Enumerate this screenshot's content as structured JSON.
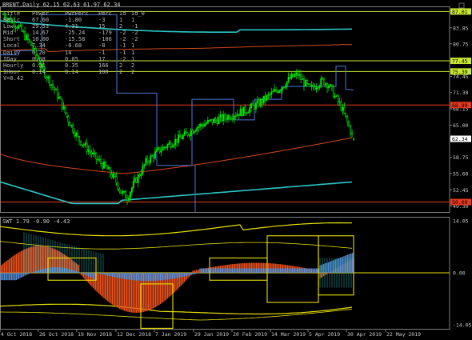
{
  "window": {
    "symbol_title": "BRENT,Daily  62.15 62.63 61.97 62.34",
    "oscillator_title": "SWT 1.79 -0.90 -4.43"
  },
  "info_table": {
    "headers": [
      "Title",
      "Power",
      "PwrPerc",
      "Perc",
      "Id",
      "Id_0"
    ],
    "rows": [
      [
        "Basic",
        "67.60",
        "-1.80",
        "-3",
        "1",
        "1"
      ],
      [
        "Low",
        "29.53",
        "4.31",
        "15",
        "2",
        "-1"
      ],
      [
        "Mid",
        "14.67",
        "-25.24",
        "-179",
        "-2",
        "-2"
      ],
      [
        "Short",
        "10.00",
        "-15.58",
        "-106",
        "-2",
        "-2"
      ],
      [
        "Local",
        "7.34",
        "-0.68",
        "-8",
        "-1",
        "1"
      ],
      [
        "Daily",
        "0.20",
        "14",
        "-1",
        "-1",
        "1"
      ],
      [
        "IDay",
        "0.08",
        "0.05",
        "17",
        "-2",
        "1"
      ],
      [
        "Hourly",
        "0.21",
        "0.35",
        "166",
        "2",
        "2"
      ],
      [
        "IHour",
        "0.14",
        "0.14",
        "100",
        "2",
        "2"
      ]
    ],
    "vol_label": "V=0.42"
  },
  "price_axis": {
    "ticks": [
      "83.85",
      "80.75",
      "77.45",
      "74.45",
      "71.30",
      "68.15",
      "65.00",
      "62.34",
      "58.75",
      "55.60",
      "52.45",
      "49.30"
    ],
    "highlight_labels": [
      {
        "text": "87.01",
        "color": "#c8e632"
      },
      {
        "text": "77.45",
        "color": "#c8e632"
      },
      {
        "text": "75.39",
        "color": "#c8e632"
      },
      {
        "text": "68.89",
        "color": "#e53a1e"
      },
      {
        "text": "62.34",
        "color": "#ffffff"
      },
      {
        "text": "50.09",
        "color": "#e53a1e"
      }
    ]
  },
  "osc_axis": {
    "ticks": [
      "14.05",
      "0.00",
      "-14.05"
    ]
  },
  "date_axis": {
    "labels": [
      "4 Oct 2018",
      "26 Oct 2018",
      "19 Nov 2018",
      "12 Dec 2018",
      "7 Jan 2019",
      "29 Jan 2019",
      "20 Feb 2019",
      "14 Mar 2019",
      "5 Apr 2019",
      "30 Apr 2019",
      "22 May 2019"
    ]
  },
  "colors": {
    "background": "#000000",
    "candle_up": "#00e000",
    "candle_down": "#000000",
    "green_line": "#c8e632",
    "red_line": "#e53a1e",
    "cyan_band": "#2ac8c8",
    "blue_step": "#4a78d8",
    "ma_red": "#d2461e",
    "osc_orange": "#e8501e",
    "osc_blue": "#5a96e6",
    "osc_yellow": "#e8e000",
    "axis": "#7f7f7f",
    "text": "#c8c8c8"
  },
  "chart_data": {
    "type": "candlestick",
    "series_name": "BRENT,Daily",
    "last": {
      "open": 62.15,
      "high": 62.63,
      "low": 61.97,
      "close": 62.34
    },
    "y_range": [
      48.0,
      88.0
    ],
    "trend_anchors": [
      [
        0,
        86.5
      ],
      [
        10,
        84.0
      ],
      [
        18,
        80.5
      ],
      [
        24,
        76.5
      ],
      [
        30,
        73.5
      ],
      [
        36,
        70.2
      ],
      [
        42,
        66.0
      ],
      [
        48,
        62.5
      ],
      [
        54,
        60.5
      ],
      [
        60,
        58.5
      ],
      [
        66,
        56.8
      ],
      [
        72,
        54.5
      ],
      [
        76,
        52.0
      ],
      [
        80,
        51.0
      ],
      [
        84,
        53.5
      ],
      [
        88,
        55.5
      ],
      [
        92,
        57.8
      ],
      [
        100,
        60.0
      ],
      [
        108,
        61.5
      ],
      [
        116,
        62.8
      ],
      [
        124,
        64.5
      ],
      [
        132,
        65.5
      ],
      [
        140,
        66.2
      ],
      [
        148,
        67.0
      ],
      [
        156,
        67.8
      ],
      [
        164,
        69.0
      ],
      [
        172,
        70.8
      ],
      [
        180,
        72.5
      ],
      [
        186,
        74.3
      ],
      [
        190,
        74.8
      ],
      [
        194,
        73.2
      ],
      [
        198,
        72.0
      ],
      [
        202,
        72.8
      ],
      [
        206,
        73.6
      ],
      [
        210,
        72.8
      ],
      [
        214,
        70.5
      ],
      [
        218,
        68.5
      ],
      [
        222,
        65.5
      ],
      [
        226,
        62.3
      ]
    ],
    "osc_range": [
      -14.05,
      14.05
    ]
  }
}
